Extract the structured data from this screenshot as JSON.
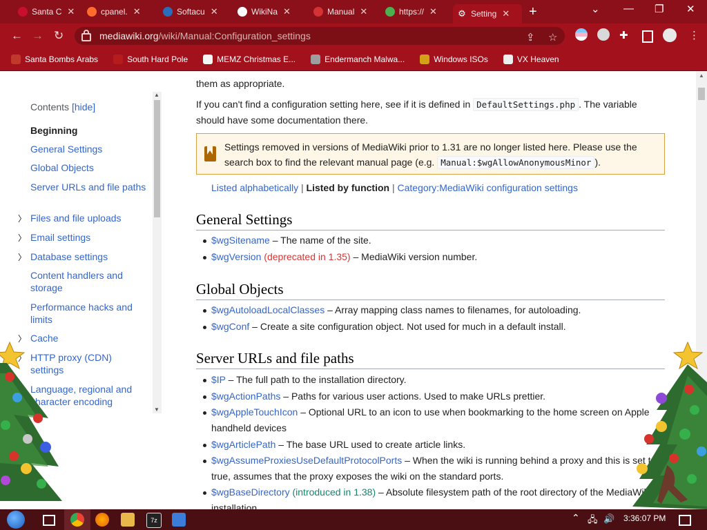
{
  "browser": {
    "tabs": [
      {
        "label": "Santa C",
        "color": "#c8102e"
      },
      {
        "label": "cpanel.",
        "color": "#ff6c2c"
      },
      {
        "label": "Softacu",
        "color": "#2a6ebb"
      },
      {
        "label": "WikiNa",
        "color": "#ffffff"
      },
      {
        "label": "Manual",
        "color": "#d33333"
      },
      {
        "label": "https://",
        "color": "#4caf50"
      },
      {
        "label": "Setting",
        "color": "#ffffff"
      }
    ],
    "url_host": "mediawiki.org",
    "url_path": "/wiki/Manual:Configuration_settings",
    "bookmarks": [
      {
        "label": "Santa Bombs Arabs",
        "color": "#c0392b"
      },
      {
        "label": "South Hard Pole",
        "color": "#b71c1c"
      },
      {
        "label": "MEMZ Christmas E...",
        "color": "#f5f5f5"
      },
      {
        "label": "Endermanch Malwa...",
        "color": "#9e9e9e"
      },
      {
        "label": "Windows ISOs",
        "color": "#d4a017"
      },
      {
        "label": "VX Heaven",
        "color": "#eeeeee"
      }
    ]
  },
  "toc": {
    "title": "Contents",
    "hide": "[hide]",
    "items": [
      {
        "label": "Beginning",
        "bold": true,
        "chevron": false
      },
      {
        "label": "General Settings",
        "chevron": false
      },
      {
        "label": "Global Objects",
        "chevron": false
      },
      {
        "label": "Server URLs and file paths",
        "chevron": false
      },
      {
        "label": "Files and file uploads",
        "chevron": true
      },
      {
        "label": "Email settings",
        "chevron": true
      },
      {
        "label": "Database settings",
        "chevron": true
      },
      {
        "label": "Content handlers and storage",
        "chevron": false
      },
      {
        "label": "Performance hacks and limits",
        "chevron": false
      },
      {
        "label": "Cache",
        "chevron": true
      },
      {
        "label": "HTTP proxy (CDN) settings",
        "chevron": true
      },
      {
        "label": "Language, regional and character encoding",
        "chevron": false
      }
    ]
  },
  "content": {
    "p0": "them as appropriate.",
    "p1_before": "If you can't find a configuration setting here, see if it is defined in ",
    "p1_code": "DefaultSettings.php",
    "p1_after": ". The variable should have some documentation there.",
    "notice_before": "Settings removed in versions of MediaWiki prior to 1.31 are no longer listed here. Please use the search box to find the relevant manual page (e.g. ",
    "notice_code": "Manual:$wgAllowAnonymousMinor",
    "notice_after": ").",
    "links": {
      "alpha": "Listed alphabetically",
      "sep": "|",
      "function": "Listed by function",
      "category": "Category:MediaWiki configuration settings"
    },
    "sections": [
      {
        "title": "General Settings",
        "items": [
          {
            "name": "$wgSitename",
            "desc": " – The name of the site."
          },
          {
            "name": "$wgVersion",
            "tag": " (deprecated in 1.35)",
            "tagtype": "dep",
            "desc": " – MediaWiki version number."
          }
        ]
      },
      {
        "title": "Global Objects",
        "items": [
          {
            "name": "$wgAutoloadLocalClasses",
            "desc": " – Array mapping class names to filenames, for autoloading."
          },
          {
            "name": "$wgConf",
            "desc": " – Create a site configuration object. Not used for much in a default install."
          }
        ]
      },
      {
        "title": "Server URLs and file paths",
        "items": [
          {
            "name": "$IP",
            "desc": " – The full path to the installation directory."
          },
          {
            "name": "$wgActionPaths",
            "desc": " – Paths for various user actions. Used to make URLs prettier."
          },
          {
            "name": "$wgAppleTouchIcon",
            "desc": " – Optional URL to an icon to use when bookmarking to the home screen on Apple handheld devices"
          },
          {
            "name": "$wgArticlePath",
            "desc": " – The base URL used to create article links."
          },
          {
            "name": "$wgAssumeProxiesUseDefaultProtocolPorts",
            "desc": " – When the wiki is running behind a proxy and this is set to true, assumes that the proxy exposes the wiki on the standard ports."
          },
          {
            "name": "$wgBaseDirectory",
            "tag": " (introduced in 1.38)",
            "tagtype": "intro",
            "desc": " – Absolute filesystem path of the root directory of the MediaWiki installation."
          }
        ]
      }
    ]
  },
  "taskbar": {
    "time": "3:36:07 PM"
  }
}
